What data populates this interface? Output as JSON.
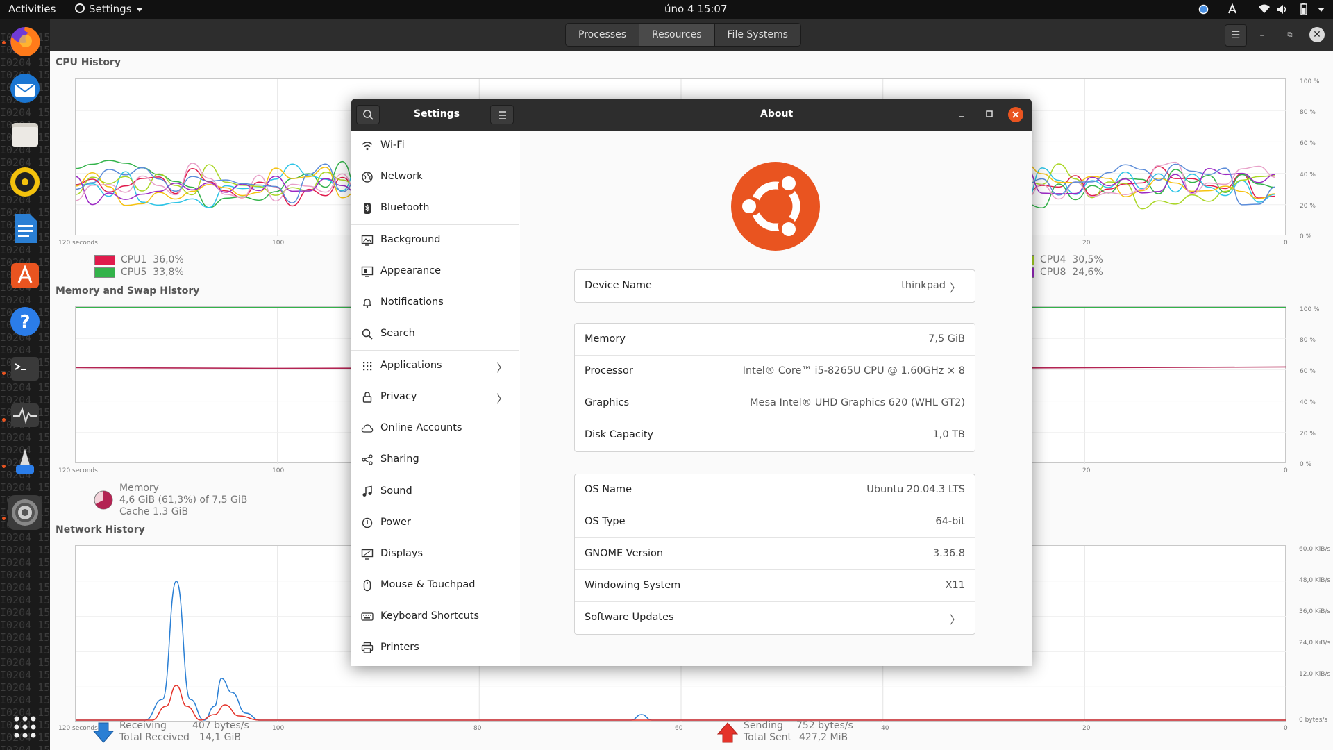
{
  "topbar": {
    "activities": "Activities",
    "app_menu": "Settings",
    "clock": "úno 4  15:07"
  },
  "sysmon": {
    "tabs": [
      "Processes",
      "Resources",
      "File Systems"
    ],
    "cpu": {
      "title": "CPU History",
      "x_ticks": [
        "120 seconds",
        "100",
        "20",
        "0"
      ],
      "y_ticks": [
        "100 %",
        "80 %",
        "60 %",
        "40 %",
        "20 %",
        "0 %"
      ],
      "legend": [
        {
          "name": "CPU1",
          "value": "36,0%",
          "color": "#e01b4c"
        },
        {
          "name": "CPU5",
          "value": "33,8%",
          "color": "#33b34a"
        },
        {
          "name": "CPU4",
          "value": "30,5%",
          "color": "#a9d624"
        },
        {
          "name": "CPU8",
          "value": "24,6%",
          "color": "#9b28c4"
        }
      ]
    },
    "memory": {
      "title": "Memory and Swap History",
      "x_ticks": [
        "120 seconds",
        "100",
        "20",
        "0"
      ],
      "y_ticks": [
        "100 %",
        "80 %",
        "60 %",
        "40 %",
        "20 %",
        "0 %"
      ],
      "legend_title": "Memory",
      "legend_line1": "4,6 GiB (61,3%) of 7,5 GiB",
      "legend_line2": "Cache 1,3 GiB"
    },
    "network": {
      "title": "Network History",
      "x_ticks": [
        "120 seconds",
        "100",
        "80",
        "60",
        "40",
        "20",
        "0"
      ],
      "y_ticks": [
        "60,0 KiB/s",
        "48,0 KiB/s",
        "36,0 KiB/s",
        "24,0 KiB/s",
        "12,0 KiB/s",
        "0 bytes/s"
      ],
      "receiving_label": "Receiving",
      "receiving_value": "407 bytes/s",
      "total_received_label": "Total Received",
      "total_received_value": "14,1 GiB",
      "sending_label": "Sending",
      "sending_value": "752 bytes/s",
      "total_sent_label": "Total Sent",
      "total_sent_value": "427,2 MiB"
    }
  },
  "settings": {
    "sidebar_title": "Settings",
    "page_title": "About",
    "sidebar_items": [
      {
        "label": "Wi-Fi",
        "icon": "wifi-icon"
      },
      {
        "label": "Network",
        "icon": "network-icon"
      },
      {
        "label": "Bluetooth",
        "icon": "bluetooth-icon"
      },
      {
        "label": "Background",
        "icon": "background-icon"
      },
      {
        "label": "Appearance",
        "icon": "appearance-icon"
      },
      {
        "label": "Notifications",
        "icon": "bell-icon"
      },
      {
        "label": "Search",
        "icon": "search-icon"
      },
      {
        "label": "Applications",
        "icon": "grid-icon"
      },
      {
        "label": "Privacy",
        "icon": "lock-icon"
      },
      {
        "label": "Online Accounts",
        "icon": "cloud-icon"
      },
      {
        "label": "Sharing",
        "icon": "share-icon"
      },
      {
        "label": "Sound",
        "icon": "music-note-icon"
      },
      {
        "label": "Power",
        "icon": "power-icon"
      },
      {
        "label": "Displays",
        "icon": "display-icon"
      },
      {
        "label": "Mouse & Touchpad",
        "icon": "mouse-icon"
      },
      {
        "label": "Keyboard Shortcuts",
        "icon": "keyboard-icon"
      },
      {
        "label": "Printers",
        "icon": "printer-icon"
      }
    ],
    "about": {
      "device_name_label": "Device Name",
      "device_name_value": "thinkpad",
      "hardware": [
        {
          "label": "Memory",
          "value": "7,5 GiB"
        },
        {
          "label": "Processor",
          "value": "Intel® Core™ i5-8265U CPU @ 1.60GHz × 8"
        },
        {
          "label": "Graphics",
          "value": "Mesa Intel® UHD Graphics 620 (WHL GT2)"
        },
        {
          "label": "Disk Capacity",
          "value": "1,0 TB"
        }
      ],
      "software": [
        {
          "label": "OS Name",
          "value": "Ubuntu 20.04.3 LTS"
        },
        {
          "label": "OS Type",
          "value": "64-bit"
        },
        {
          "label": "GNOME Version",
          "value": "3.36.8"
        },
        {
          "label": "Windowing System",
          "value": "X11"
        }
      ],
      "software_updates_label": "Software Updates"
    }
  },
  "terminal_bg_line": "I0204 15"
}
